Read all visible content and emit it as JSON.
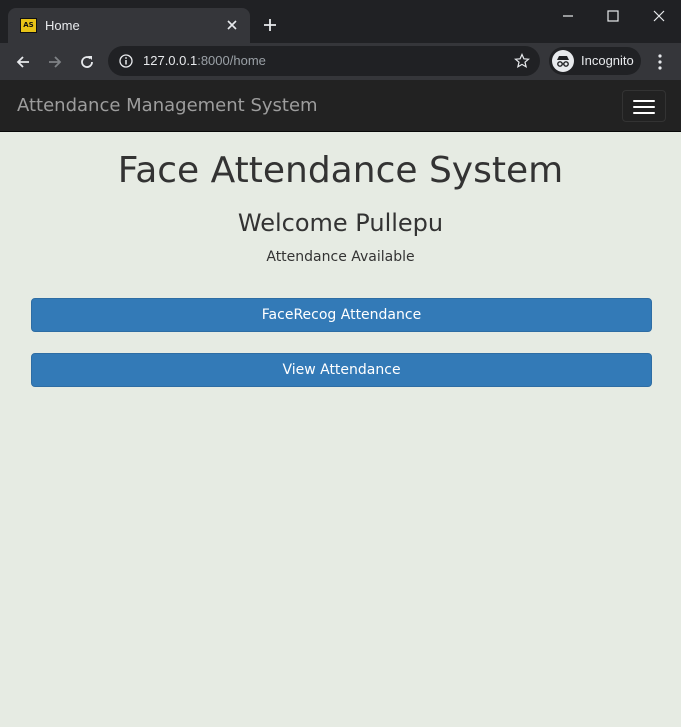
{
  "browser": {
    "tab_title": "Home",
    "favicon_text": "AS",
    "url_host": "127.0.0.1",
    "url_rest": ":8000/home",
    "incognito_label": "Incognito"
  },
  "navbar": {
    "brand": "Attendance Management System"
  },
  "main": {
    "title": "Face Attendance System",
    "welcome": "Welcome Pullepu",
    "status": "Attendance Available",
    "buttons": [
      {
        "label": "FaceRecog Attendance"
      },
      {
        "label": "View Attendance"
      }
    ]
  },
  "colors": {
    "primary": "#337ab7",
    "navbar": "#222222",
    "background": "#e6ebe3"
  }
}
